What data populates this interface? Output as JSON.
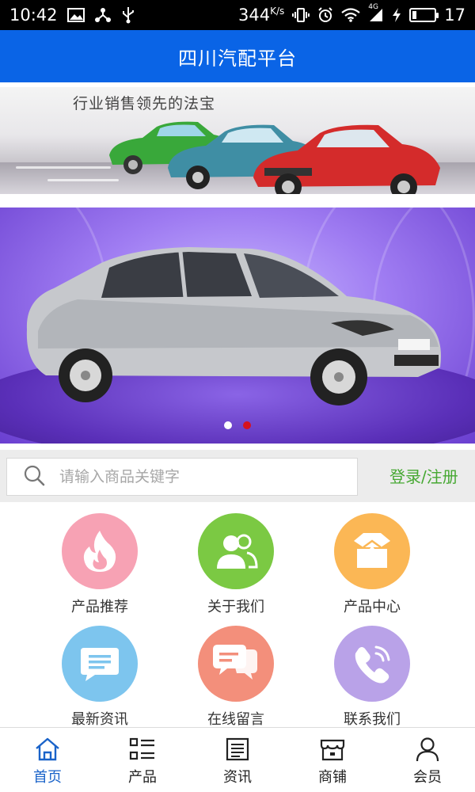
{
  "status_bar": {
    "time": "10:42",
    "speed": "344",
    "speed_unit": "K/s",
    "network": "4G",
    "battery_level": "17",
    "battery_fraction": 0.17
  },
  "header": {
    "title": "四川汽配平台"
  },
  "banner_top": {
    "slogan": "行业销售领先的法宝"
  },
  "carousel": {
    "slide_count": 2,
    "active_index": 1,
    "active_dot_color": "#d6121f"
  },
  "search": {
    "placeholder": "请输入商品关键字",
    "value": ""
  },
  "auth": {
    "label": "登录/注册"
  },
  "grid": {
    "items": [
      {
        "label": "产品推荐",
        "icon": "flame-icon",
        "color": "#f7a2b4"
      },
      {
        "label": "关于我们",
        "icon": "people-icon",
        "color": "#7bc943"
      },
      {
        "label": "产品中心",
        "icon": "box-icon",
        "color": "#fbb755"
      },
      {
        "label": "最新资讯",
        "icon": "message-icon",
        "color": "#7dc5ee"
      },
      {
        "label": "在线留言",
        "icon": "chat-bubbles-icon",
        "color": "#f38f7b"
      },
      {
        "label": "联系我们",
        "icon": "phone-icon",
        "color": "#b9a2e8"
      }
    ]
  },
  "bottom_nav": {
    "items": [
      {
        "label": "首页",
        "icon": "home-icon",
        "active": true
      },
      {
        "label": "产品",
        "icon": "list-icon",
        "active": false
      },
      {
        "label": "资讯",
        "icon": "document-icon",
        "active": false
      },
      {
        "label": "商铺",
        "icon": "store-icon",
        "active": false
      },
      {
        "label": "会员",
        "icon": "user-icon",
        "active": false
      }
    ]
  },
  "colors": {
    "brand_blue": "#0a64e6",
    "nav_active": "#1a63c9",
    "login_green": "#46a832"
  }
}
